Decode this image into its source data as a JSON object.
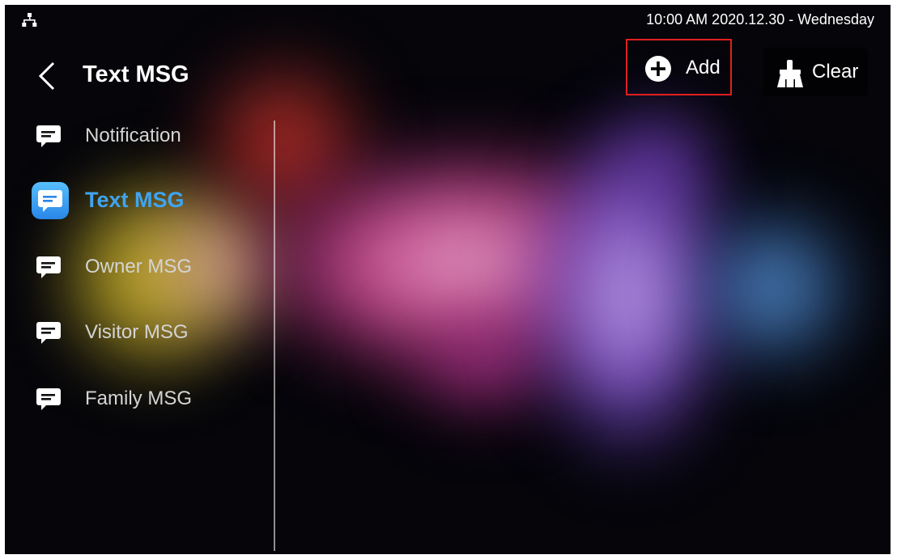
{
  "status_bar": {
    "network_icon": "network-topology-icon",
    "datetime": "10:00 AM  2020.12.30 - Wednesday"
  },
  "header": {
    "back_icon": "chevron-left-icon",
    "title": "Text MSG"
  },
  "toolbar": {
    "add_label": "Add",
    "add_icon": "plus-circle-icon",
    "clear_label": "Clear",
    "clear_icon": "broom-icon",
    "highlight_color": "#e02020"
  },
  "sidebar": {
    "active_color": "#3fa4f0",
    "items": [
      {
        "label": "Notification",
        "icon": "message-icon",
        "active": false
      },
      {
        "label": "Text MSG",
        "icon": "message-icon",
        "active": true
      },
      {
        "label": "Owner MSG",
        "icon": "message-icon",
        "active": false
      },
      {
        "label": "Visitor MSG",
        "icon": "message-icon",
        "active": false
      },
      {
        "label": "Family MSG",
        "icon": "message-icon",
        "active": false
      }
    ]
  }
}
